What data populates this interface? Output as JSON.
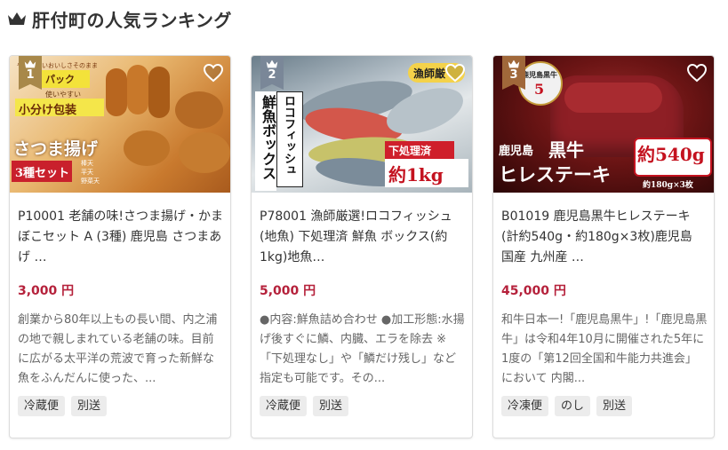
{
  "heading": {
    "icon": "crown-icon",
    "title": "肝付町の人気ランキング",
    "icon_color": "#333333"
  },
  "items": [
    {
      "rank": "1",
      "image_text": {
        "t1": "やわらかいおいしさそのまま",
        "t2": "パック",
        "t3": "使いやすい",
        "t4": "小分け包装",
        "t5": "さつま揚げ",
        "t6": "3種セット",
        "t7": "棒天",
        "t8": "平天",
        "t9": "野菜天"
      },
      "name": "P10001 老舗の味!さつま揚げ・かまぼこセット A (3種) 鹿児島 さつまあげ …",
      "price": "3,000 円",
      "description": "創業から80年以上もの長い間、内之浦の地で親しまれている老舗の味。目前に広がる太平洋の荒波で育った新鮮な魚をふんだんに使った、...",
      "tags": [
        "冷蔵便",
        "別送"
      ]
    },
    {
      "rank": "2",
      "image_text": {
        "t1": "漁師厳",
        "t2": "ロコフィッシュ",
        "t3": "鮮魚ボックス",
        "t4": "下処理済",
        "t5": "約1kg"
      },
      "name": "P78001 漁師厳選!ロコフィッシュ(地魚) 下処理済 鮮魚 ボックス(約1kg)地魚…",
      "price": "5,000 円",
      "description": "●内容:鮮魚詰め合わせ ●加工形態:水揚げ後すぐに鱗、内臓、エラを除去 ※「下処理なし」や「鱗だけ残し」など指定も可能です。その...",
      "tags": [
        "冷蔵便",
        "別送"
      ]
    },
    {
      "rank": "3",
      "image_text": {
        "t1": "鹿児島黒牛",
        "t2": "5",
        "t3": "鹿児島",
        "t4": "黒牛",
        "t5": "ヒレステーキ",
        "t6": "約540g",
        "t7": "約180g×3枚"
      },
      "name": "B01019 鹿児島黒牛ヒレステーキ(計約540g・約180g×3枚)鹿児島 国産 九州産 …",
      "price": "45,000 円",
      "description": "和牛日本一!「鹿児島黒牛」!「鹿児島黒牛」は令和4年10月に開催された5年に1度の「第12回全国和牛能力共進会」において 内閣...",
      "tags": [
        "冷凍便",
        "のし",
        "別送"
      ]
    }
  ],
  "colors": {
    "price": "#b5213b",
    "rank1": "#a8884a",
    "rank2": "#7a8798",
    "rank3": "#a0683a"
  },
  "icons": {
    "favorite": "heart-outline-icon",
    "rank": "crown-icon"
  }
}
